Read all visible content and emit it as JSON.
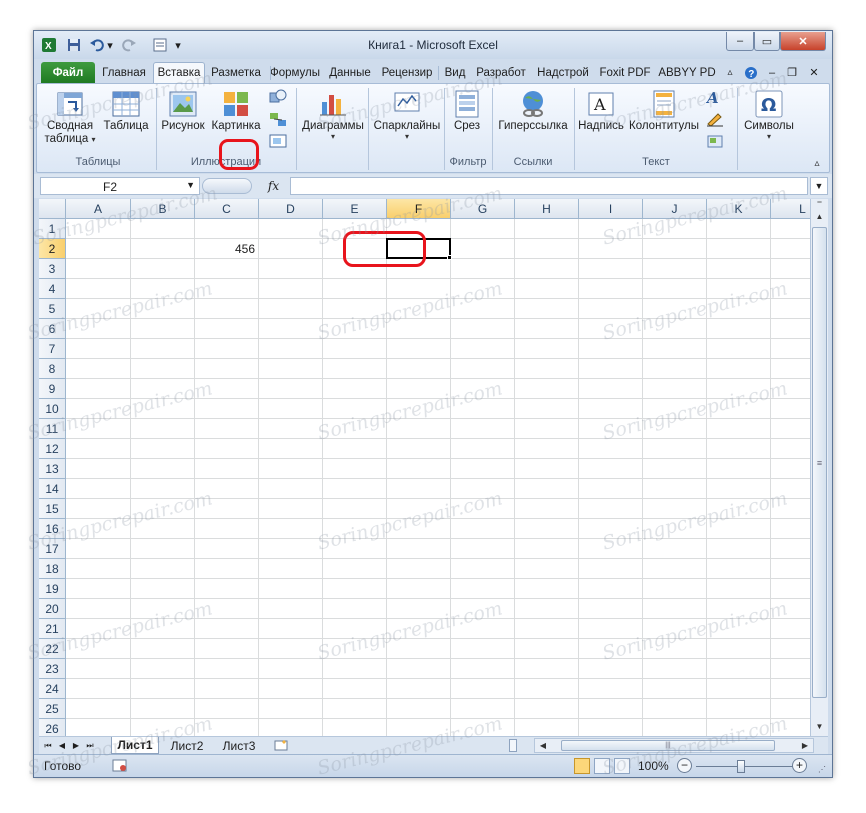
{
  "window": {
    "title": "Книга1  -  Microsoft Excel",
    "controls": {
      "minimize": "–",
      "restore": "▭",
      "close": "✕"
    }
  },
  "qat": {
    "save": "save-icon",
    "undo": "undo-icon",
    "redo": "redo-icon",
    "customize": "▾"
  },
  "ribbon_tabs": [
    {
      "label": "Файл",
      "active": false
    },
    {
      "label": "Главная",
      "active": false
    },
    {
      "label": "Вставка",
      "active": true
    },
    {
      "label": "Разметка",
      "active": false
    },
    {
      "label": "Формулы",
      "active": false
    },
    {
      "label": "Данные",
      "active": false
    },
    {
      "label": "Рецензир",
      "active": false
    },
    {
      "label": "Вид",
      "active": false
    },
    {
      "label": "Разработ",
      "active": false
    },
    {
      "label": "Надстрой",
      "active": false
    },
    {
      "label": "Foxit PDF",
      "active": false
    },
    {
      "label": "ABBYY PD",
      "active": false
    }
  ],
  "ribbon": {
    "pivot_table": {
      "line1": "Сводная",
      "line2": "таблица"
    },
    "table": "Таблица",
    "picture": "Рисунок",
    "clipart": "Картинка",
    "charts": "Диаграммы",
    "sparklines": "Спарклайны",
    "slicer": "Срез",
    "hyperlink": "Гиперссылка",
    "textbox": "Надпись",
    "header_footer": "Колонтитулы",
    "symbols": "Символы",
    "groups": {
      "tables": "Таблицы",
      "illustrations": "Иллюстрации",
      "filter": "Фильтр",
      "links": "Ссылки",
      "text": "Текст"
    }
  },
  "formula_bar": {
    "name_box": "F2",
    "fx": "fx",
    "value": ""
  },
  "grid": {
    "columns": [
      "A",
      "B",
      "C",
      "D",
      "E",
      "F",
      "G",
      "H",
      "I",
      "J",
      "K",
      "L"
    ],
    "selected_column": "F",
    "rows": [
      "1",
      "2",
      "3",
      "4",
      "5",
      "6",
      "7",
      "8",
      "9",
      "10",
      "11",
      "12",
      "13",
      "14",
      "15",
      "16",
      "17",
      "18",
      "19",
      "20",
      "21",
      "22",
      "23",
      "24",
      "25",
      "26"
    ],
    "selected_row": "2",
    "cells": {
      "C2": "456"
    }
  },
  "sheets": {
    "tabs": [
      "Лист1",
      "Лист2",
      "Лист3"
    ],
    "active": "Лист1"
  },
  "status": {
    "ready": "Готово",
    "zoom": "100%"
  },
  "watermark": "Soringpcrepair.com"
}
